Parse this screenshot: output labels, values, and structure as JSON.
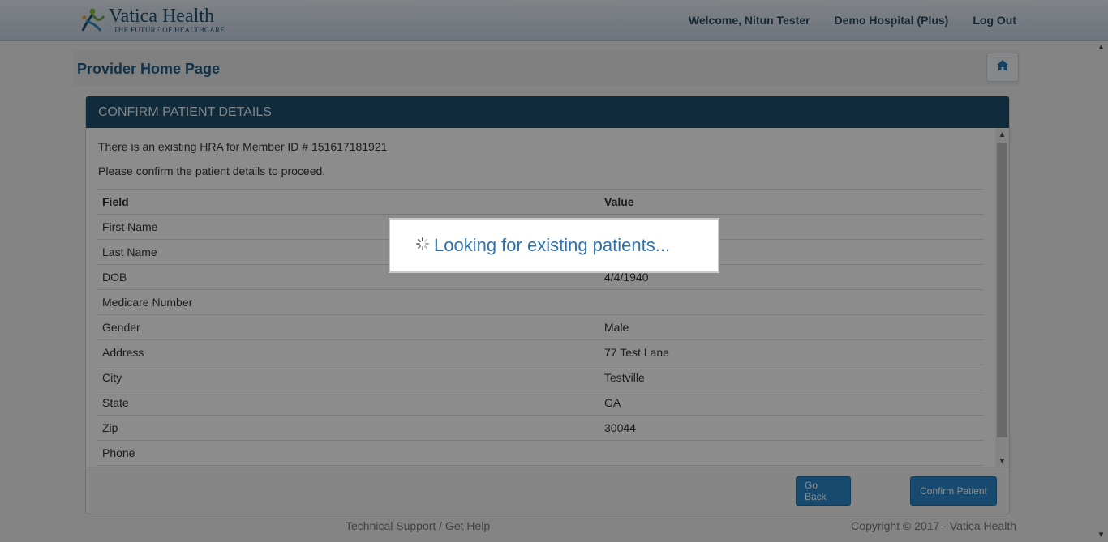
{
  "header": {
    "brand_name": "Vatica Health",
    "brand_tagline": "THE FUTURE OF HEALTHCARE",
    "welcome": "Welcome, Nitun Tester",
    "organization": "Demo Hospital (Plus)",
    "logout": "Log Out"
  },
  "page": {
    "title": "Provider Home Page"
  },
  "panel": {
    "heading": "CONFIRM PATIENT DETAILS",
    "message_1": "There is an existing HRA for Member ID # 151617181921",
    "message_2": "Please confirm the patient details to proceed.",
    "columns": [
      "Field",
      "Value"
    ],
    "rows": [
      {
        "field": "First Name",
        "value": ""
      },
      {
        "field": "Last Name",
        "value": ""
      },
      {
        "field": "DOB",
        "value": "4/4/1940"
      },
      {
        "field": "Medicare Number",
        "value": ""
      },
      {
        "field": "Gender",
        "value": "Male"
      },
      {
        "field": "Address",
        "value": "77 Test Lane"
      },
      {
        "field": "City",
        "value": "Testville"
      },
      {
        "field": "State",
        "value": "GA"
      },
      {
        "field": "Zip",
        "value": "30044"
      },
      {
        "field": "Phone",
        "value": ""
      }
    ],
    "go_back": "Go Back",
    "confirm": "Confirm Patient"
  },
  "footer": {
    "support": "Technical Support / Get Help",
    "copyright": "Copyright © 2017 - Vatica Health"
  },
  "loading": {
    "text": "Looking for existing patients..."
  },
  "colors": {
    "header_panel": "#1d4f6e",
    "button": "#2b88c8",
    "title": "#1f5d86"
  }
}
